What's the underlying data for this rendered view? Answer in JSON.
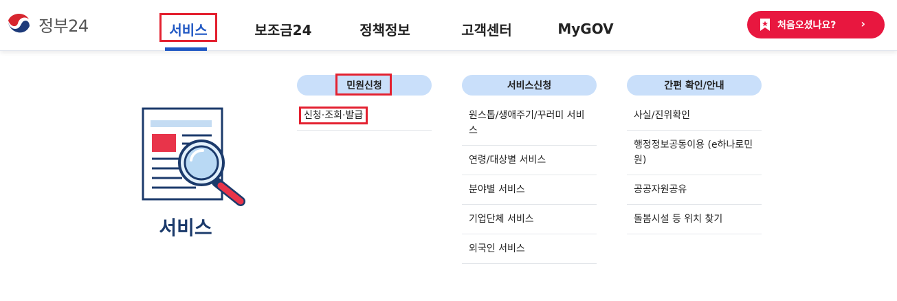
{
  "header": {
    "logo_text": "정부24",
    "nav": [
      {
        "label": "서비스",
        "active": true
      },
      {
        "label": "보조금24",
        "active": false
      },
      {
        "label": "정책정보",
        "active": false
      },
      {
        "label": "고객센터",
        "active": false
      },
      {
        "label": "MyGOV",
        "active": false
      }
    ],
    "cta_label": "처음오셨나요?",
    "cta_arrow": "›"
  },
  "section": {
    "title": "서비스",
    "illustration": "document-search-icon"
  },
  "columns": [
    {
      "heading": "민원신청",
      "items": [
        "신청·조회·발급"
      ]
    },
    {
      "heading": "서비스신청",
      "items": [
        "원스톱/생애주기/꾸러미 서비스",
        "연령/대상별 서비스",
        "분야별 서비스",
        "기업단체 서비스",
        "외국인 서비스"
      ]
    },
    {
      "heading": "간편 확인/안내",
      "items": [
        "사실/진위확인",
        "행정정보공동이용 (e하나로민원)",
        "공공자원공유",
        "돌봄시설 등 위치 찾기"
      ]
    }
  ],
  "colors": {
    "brand_blue": "#1f57c3",
    "cta_red": "#e8173f",
    "highlight_red": "#e3202f",
    "pill_blue": "#c9dffa",
    "title_navy": "#1b3a6b"
  }
}
